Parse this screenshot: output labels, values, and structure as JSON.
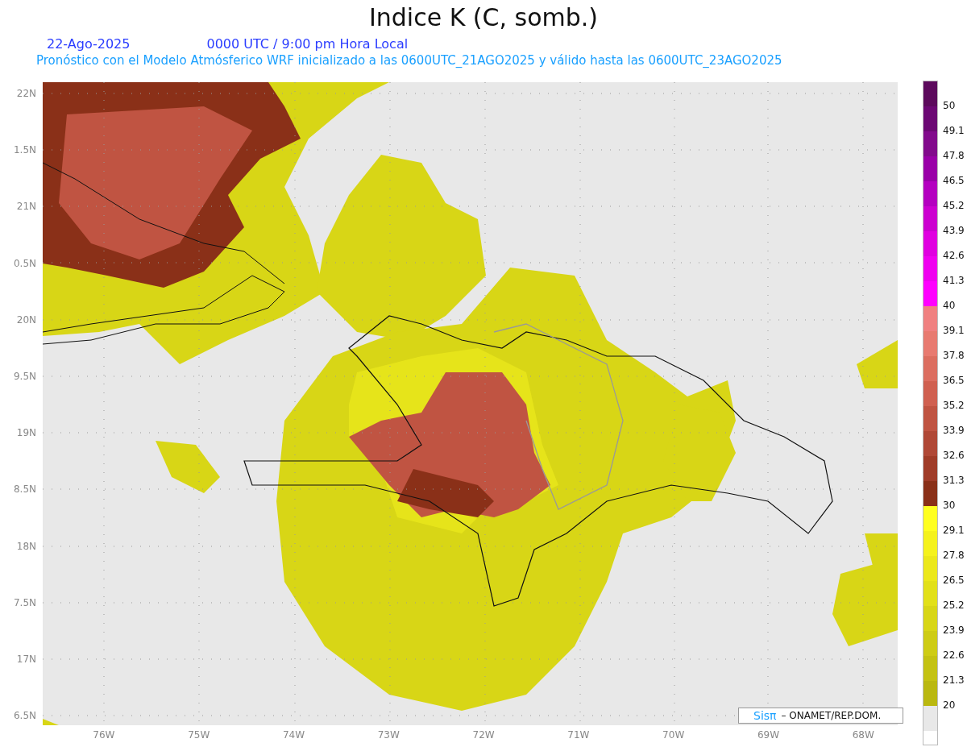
{
  "title": "Indice K (C, somb.)",
  "subtitle": {
    "date": "22-Ago-2025",
    "time": "0000 UTC / 9:00 pm Hora Local",
    "forecast": "Pronóstico con el Modelo Atmósferico WRF inicializado a las 0600UTC_21AGO2025 y válido hasta las  0600UTC_23AGO2025"
  },
  "y_axis": [
    "22N",
    "1.5N",
    "21N",
    "0.5N",
    "20N",
    "9.5N",
    "19N",
    "8.5N",
    "18N",
    "7.5N",
    "17N",
    "6.5N"
  ],
  "x_axis": [
    "76W",
    "75W",
    "74W",
    "73W",
    "72W",
    "71W",
    "70W",
    "69W",
    "68W"
  ],
  "credit": {
    "logo": "Sisπ",
    "text": "– ONAMET/REP.DOM."
  },
  "colorbar": {
    "bins": [
      {
        "color": "#5c0a5c"
      },
      {
        "color": "#6c0874"
      },
      {
        "color": "#820a8c"
      },
      {
        "color": "#9a00a8"
      },
      {
        "color": "#b400c0"
      },
      {
        "color": "#cc00d0"
      },
      {
        "color": "#e000e0"
      },
      {
        "color": "#f000f0"
      },
      {
        "color": "#ff00ff"
      },
      {
        "color": "#f08080"
      },
      {
        "color": "#e87a70"
      },
      {
        "color": "#dc6e60"
      },
      {
        "color": "#d06050"
      },
      {
        "color": "#c05442"
      },
      {
        "color": "#b04836"
      },
      {
        "color": "#a03c28"
      },
      {
        "color": "#8a3018"
      },
      {
        "color": "#ffff20"
      },
      {
        "color": "#f5f21c"
      },
      {
        "color": "#ece81a"
      },
      {
        "color": "#e2e018"
      },
      {
        "color": "#d8d616"
      },
      {
        "color": "#cecc14"
      },
      {
        "color": "#c4c212"
      },
      {
        "color": "#bab810"
      },
      {
        "color": "#e8e8e8"
      }
    ],
    "labels": [
      "50",
      "49.1",
      "47.8",
      "46.5",
      "45.2",
      "43.9",
      "42.6",
      "41.3",
      "40",
      "39.1",
      "37.8",
      "36.5",
      "35.2",
      "33.9",
      "32.6",
      "31.3",
      "30",
      "29.1",
      "27.8",
      "26.5",
      "25.2",
      "23.9",
      "22.6",
      "21.3",
      "20"
    ]
  }
}
